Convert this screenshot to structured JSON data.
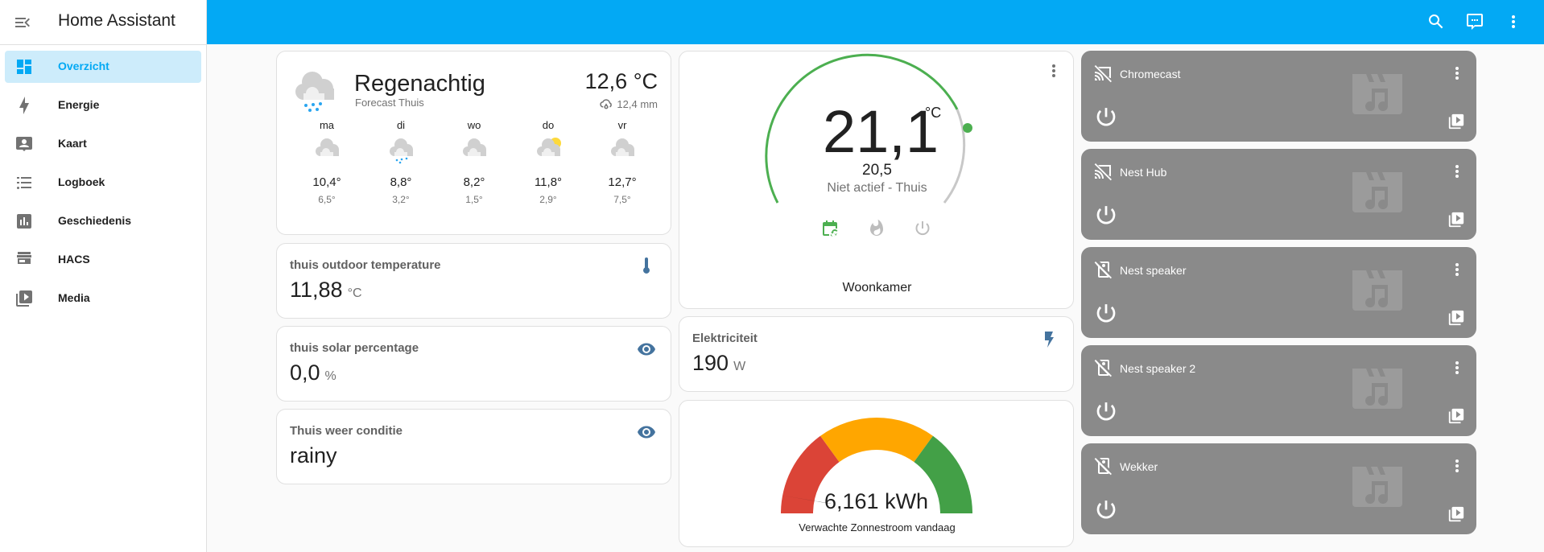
{
  "app": {
    "title": "Home Assistant"
  },
  "sidebar": {
    "items": [
      {
        "label": "Overzicht",
        "icon": "view-dashboard-icon",
        "active": true
      },
      {
        "label": "Energie",
        "icon": "lightning-bolt-icon"
      },
      {
        "label": "Kaart",
        "icon": "account-box-icon"
      },
      {
        "label": "Logboek",
        "icon": "format-list-bulleted-icon"
      },
      {
        "label": "Geschiedenis",
        "icon": "chart-box-icon"
      },
      {
        "label": "HACS",
        "icon": "hacs-icon"
      },
      {
        "label": "Media",
        "icon": "play-box-multiple-icon"
      }
    ]
  },
  "header": {
    "color": "#03a9f4",
    "actions": [
      "search-icon",
      "chat-icon",
      "dots-vertical-icon"
    ]
  },
  "weather": {
    "condition": "Regenachtig",
    "name": "Forecast Thuis",
    "temperature": "12,6 °C",
    "precipitation": "12,4 mm",
    "forecast": [
      {
        "day": "ma",
        "icon": "cloudy",
        "high": "10,4°",
        "low": "6,5°"
      },
      {
        "day": "di",
        "icon": "rainy",
        "high": "8,8°",
        "low": "3,2°"
      },
      {
        "day": "wo",
        "icon": "cloudy",
        "high": "8,2°",
        "low": "1,5°"
      },
      {
        "day": "do",
        "icon": "partlycloudy",
        "high": "11,8°",
        "low": "2,9°"
      },
      {
        "day": "vr",
        "icon": "cloudy",
        "high": "12,7°",
        "low": "7,5°"
      }
    ]
  },
  "entities": [
    {
      "name": "thuis outdoor temperature",
      "value": "11,88",
      "unit": "°C",
      "icon": "thermometer-icon"
    },
    {
      "name": "thuis solar percentage",
      "value": "0,0",
      "unit": "%",
      "icon": "eye-icon"
    },
    {
      "name": "Thuis weer conditie",
      "value": "rainy",
      "unit": "",
      "icon": "eye-icon"
    }
  ],
  "thermostat": {
    "current": "21,1",
    "unit": "°C",
    "target": "20,5",
    "status": "Niet actief - Thuis",
    "name": "Woonkamer",
    "modes": [
      "calendar-sync-icon",
      "fire-icon",
      "power-icon"
    ],
    "accent": "#4caf50"
  },
  "electricity": {
    "name": "Elektriciteit",
    "value": "190",
    "unit": "W",
    "icon": "flash-icon"
  },
  "solar_gauge": {
    "value": "6,161 kWh",
    "label": "Verwachte Zonnestroom vandaag",
    "needle_fraction": 0.06,
    "colors": [
      "#db4437",
      "#ffa600",
      "#43a047"
    ]
  },
  "media_players": [
    {
      "name": "Chromecast",
      "icon": "cast-off-icon"
    },
    {
      "name": "Nest Hub",
      "icon": "cast-off-icon"
    },
    {
      "name": "Nest speaker",
      "icon": "speaker-off-icon"
    },
    {
      "name": "Nest speaker 2",
      "icon": "speaker-off-icon"
    },
    {
      "name": "Wekker",
      "icon": "speaker-off-icon"
    }
  ]
}
